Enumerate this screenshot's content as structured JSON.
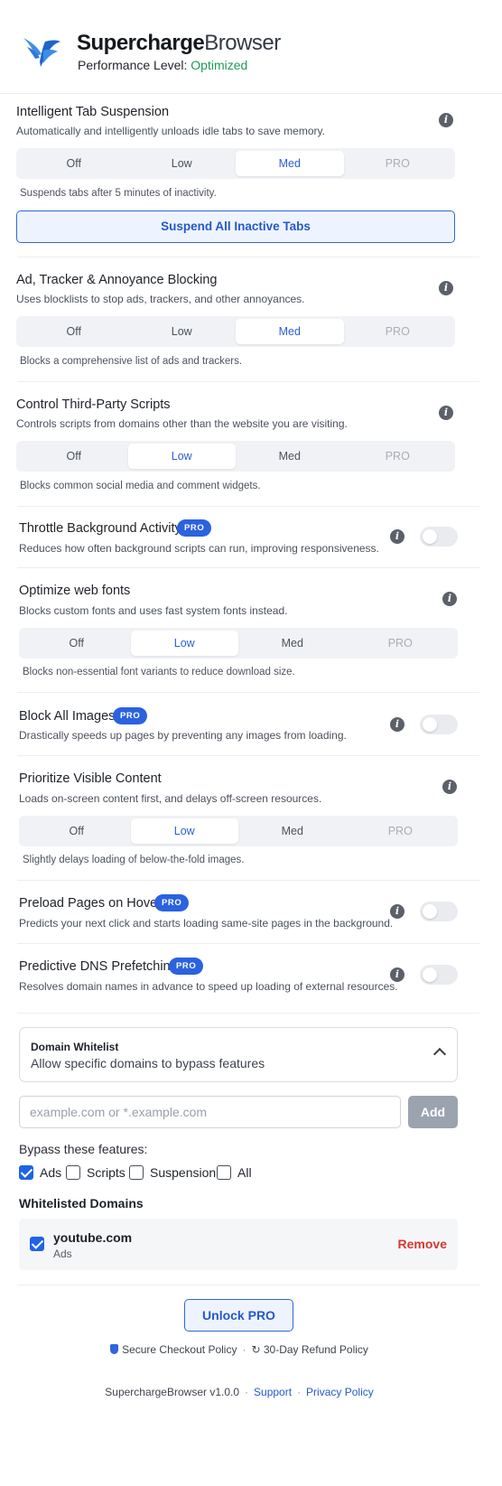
{
  "app": {
    "name_bold": "Supercharge",
    "name_light": "Browser",
    "perf_label": "Performance Level:",
    "perf_value": "Optimized"
  },
  "sections": {
    "suspension": {
      "title": "Intelligent Tab Suspension",
      "desc": "Automatically and intelligently unloads idle tabs to save memory.",
      "options": [
        "Off",
        "Low",
        "Med",
        "PRO"
      ],
      "selected": "Med",
      "hint": "Suspends tabs after 5 minutes of inactivity.",
      "button": "Suspend All Inactive Tabs"
    },
    "blocking": {
      "title": "Ad, Tracker & Annoyance Blocking",
      "desc": "Uses blocklists to stop ads, trackers, and other annoyances.",
      "options": [
        "Off",
        "Low",
        "Med",
        "PRO"
      ],
      "selected": "Med",
      "hint": "Blocks a comprehensive list of ads and trackers."
    },
    "scripts": {
      "title": "Control Third-Party Scripts",
      "desc": "Controls scripts from domains other than the website you are visiting.",
      "options": [
        "Off",
        "Low",
        "Med",
        "PRO"
      ],
      "selected": "Low",
      "hint": "Blocks common social media and comment widgets."
    },
    "throttle": {
      "title": "Throttle Background Activity",
      "badge": "PRO",
      "desc": "Reduces how often background scripts can run, improving responsiveness.",
      "enabled": false
    },
    "fonts": {
      "title": "Optimize web fonts",
      "desc": "Blocks custom fonts and uses fast system fonts instead.",
      "options": [
        "Off",
        "Low",
        "Med",
        "PRO"
      ],
      "selected": "Low",
      "hint": "Blocks non-essential font variants to reduce download size."
    },
    "images": {
      "title": "Block All Images",
      "badge": "PRO",
      "desc": "Drastically speeds up pages by preventing any images from loading.",
      "enabled": false
    },
    "visible": {
      "title": "Prioritize Visible Content",
      "desc": "Loads on-screen content first, and delays off-screen resources.",
      "options": [
        "Off",
        "Low",
        "Med",
        "PRO"
      ],
      "selected": "Low",
      "hint": "Slightly delays loading of below-the-fold images."
    },
    "preload": {
      "title": "Preload Pages on Hover",
      "badge": "PRO",
      "desc": "Predicts your next click and starts loading same-site pages in the background.",
      "enabled": false
    },
    "dns": {
      "title": "Predictive DNS Prefetching",
      "badge": "PRO",
      "desc": "Resolves domain names in advance to speed up loading of external resources.",
      "enabled": false
    }
  },
  "whitelist": {
    "title": "Domain Whitelist",
    "subtitle": "Allow specific domains to bypass features",
    "input_placeholder": "example.com or *.example.com",
    "add_label": "Add",
    "bypass_label": "Bypass these features:",
    "features": [
      {
        "label": "Ads",
        "checked": true
      },
      {
        "label": "Scripts",
        "checked": false
      },
      {
        "label": "Suspension",
        "checked": false
      },
      {
        "label": "All",
        "checked": false
      }
    ],
    "list_title": "Whitelisted Domains",
    "domains": [
      {
        "domain": "youtube.com",
        "features": "Ads",
        "remove_label": "Remove",
        "checked": true
      }
    ]
  },
  "footer": {
    "unlock_label": "Unlock PRO",
    "secure": "Secure Checkout Policy",
    "refund": "30-Day Refund Policy",
    "refund_icon": "↻",
    "version": "SuperchargeBrowser v1.0.0",
    "support": "Support",
    "privacy": "Privacy Policy"
  },
  "colors": {
    "accent": "#2a62e0",
    "ok": "#1e9a55",
    "danger": "#d23a2f"
  }
}
